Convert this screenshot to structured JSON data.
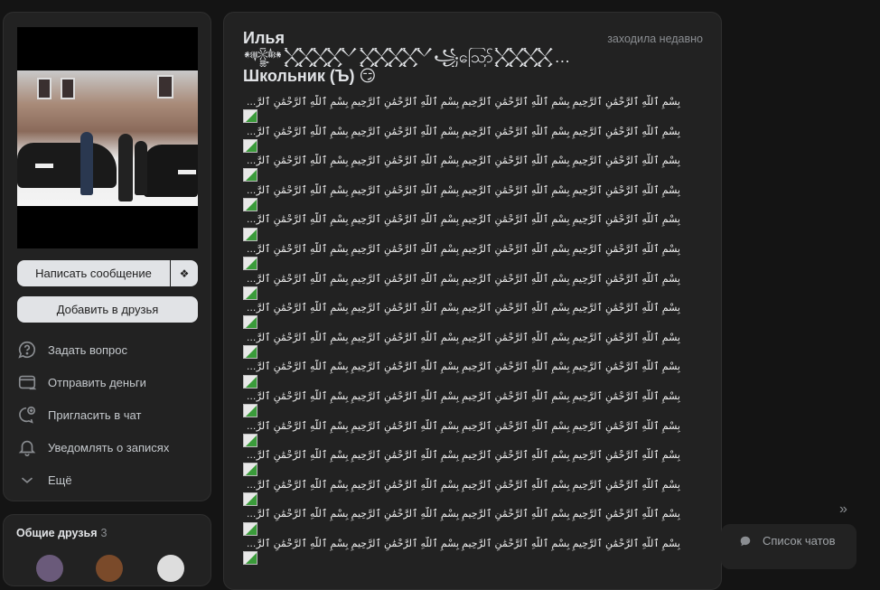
{
  "profile": {
    "name_line1": "Илья",
    "name_line2": "𒀱𒐫𒐫꧁ဪ𒐪𒐫𒀭𒈙...",
    "name_line3": "Школьник (Ъ) 😏",
    "last_seen": "заходила недавно",
    "status_lines": [
      "بِسْمِ ٱللَّهِ ٱلرَّحْمَٰنِ ٱلرَّحِيمِ بِسْمِ ٱللَّهِ ٱلرَّحْمَٰنِ ٱلرَّحِيمِ بِسْمِ ٱللَّهِ ٱلرَّحْمَٰنِ ٱلرَّحِيمِ بِسْمِ ٱللَّهِ ٱلرَّحْمَٰنِ ٱلرَّحِيمِ بِسْمِ ٱللَّهِ ٱلرَّحْمَٰنِ ٱلرَّحِيمِ بِسْمِ ٱللَّهِ ٱلرَّحْمَٰنِ ٱلرَّحِيمِ"
    ]
  },
  "actions": {
    "message": "Написать сообщение",
    "gift_icon": "gift-icon",
    "add_friend": "Добавить в друзья"
  },
  "menu": [
    {
      "label": "Задать вопрос",
      "icon": "question-bubble-icon"
    },
    {
      "label": "Отправить деньги",
      "icon": "card-transfer-icon"
    },
    {
      "label": "Пригласить в чат",
      "icon": "chat-add-icon"
    },
    {
      "label": "Уведомлять о записях",
      "icon": "bell-icon"
    },
    {
      "label": "Ещё",
      "icon": "chevron-down-icon"
    }
  ],
  "friends": {
    "title": "Общие друзья",
    "count": "3"
  },
  "chats": {
    "label": "Список чатов"
  },
  "collapse": "»"
}
